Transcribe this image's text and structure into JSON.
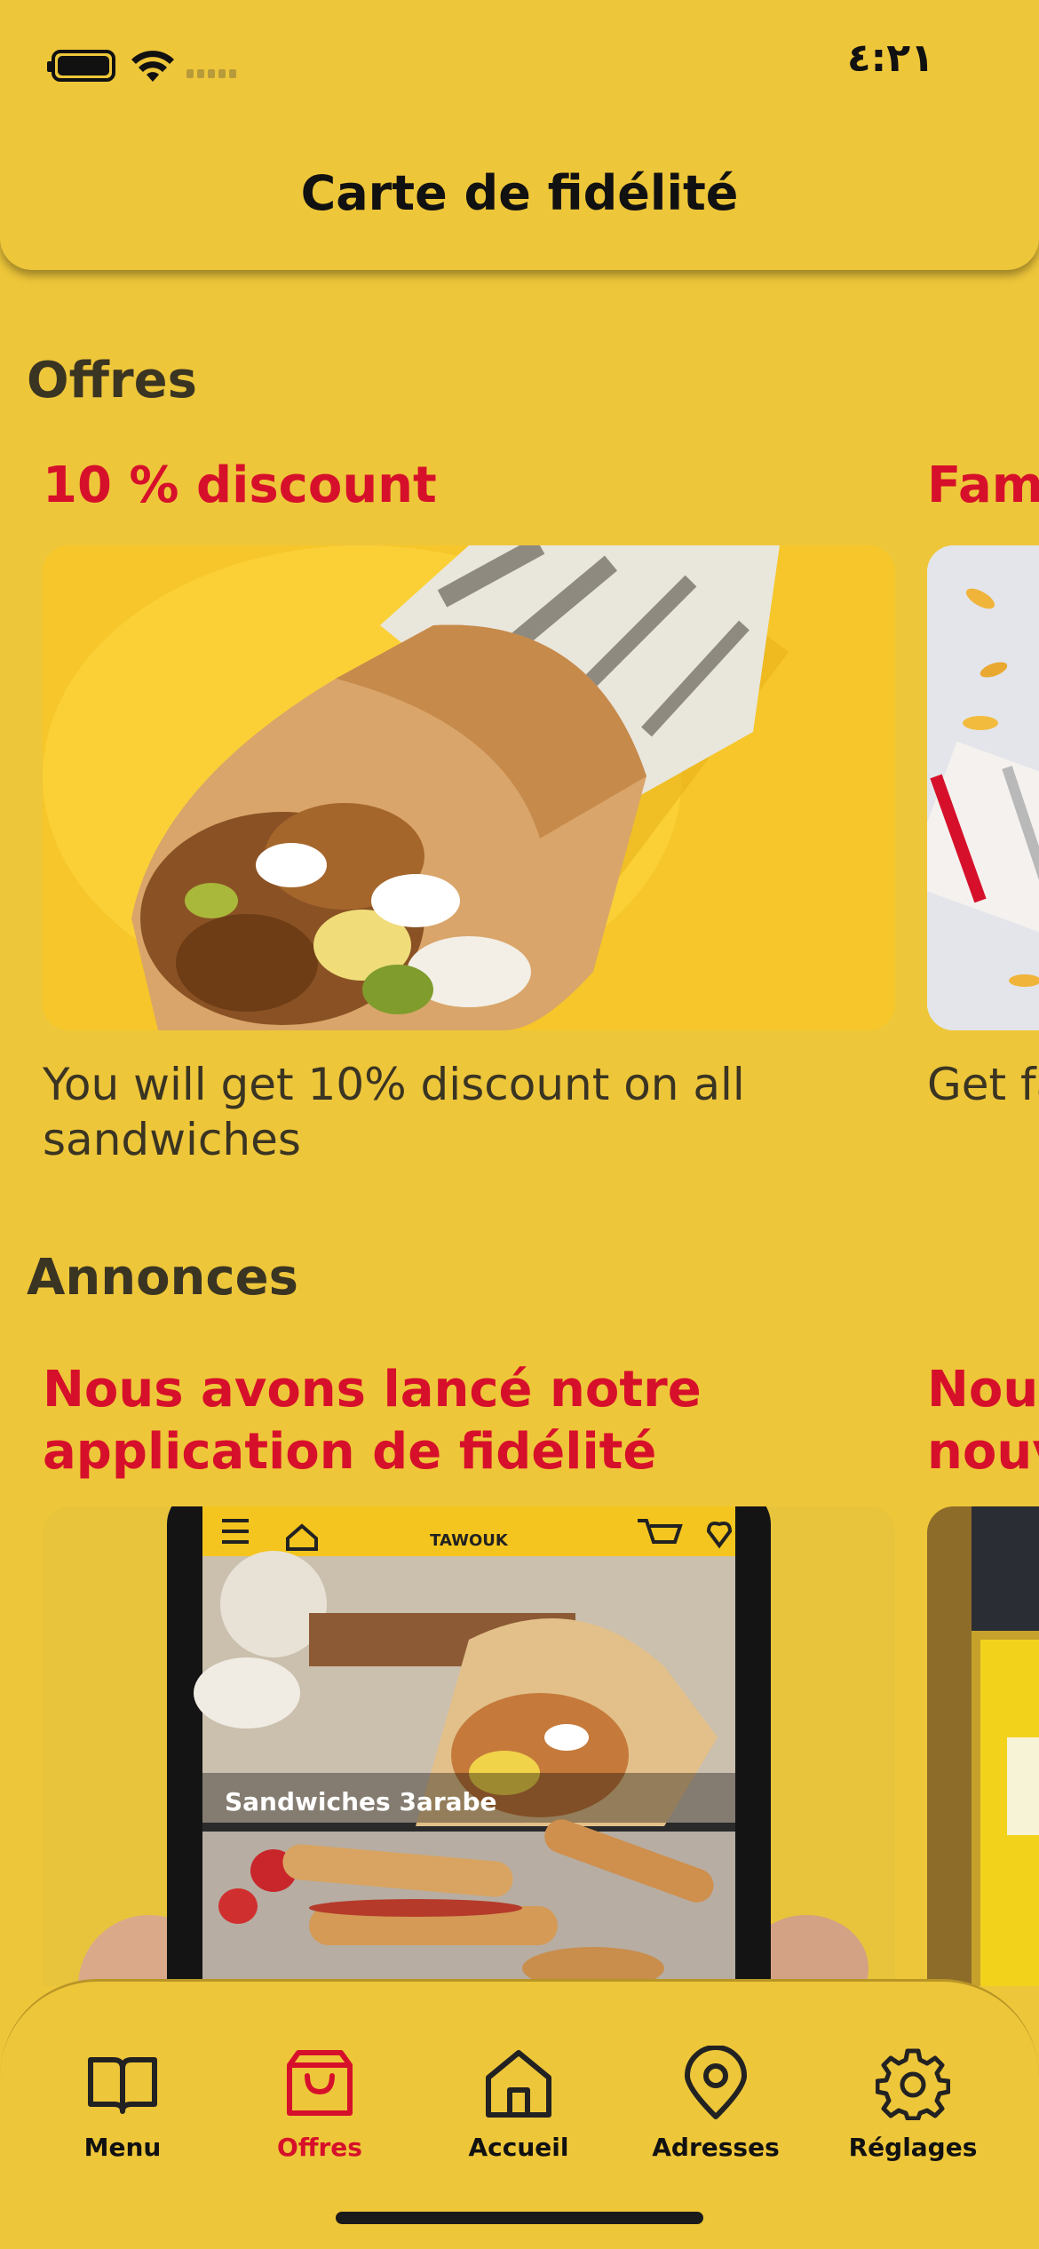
{
  "status_bar": {
    "time": "٤:٢١"
  },
  "header": {
    "title": "Carte de fidélité"
  },
  "offres": {
    "section_title": "Offres",
    "cards": [
      {
        "title": "10 % discount",
        "description": "You will get 10% discount on all sandwiches",
        "image": "tawouk-wrap-photo"
      },
      {
        "title": "Fam",
        "description": "Get fa",
        "image": "fries-wrap-photo"
      }
    ]
  },
  "annonces": {
    "section_title": "Annonces",
    "cards": [
      {
        "title_line1": "Nous avons lancé notre",
        "title_line2": "application de fidélité",
        "image": "app-phone-photo",
        "image_text": {
          "logo": "TAWOUK",
          "menu_item": "Sandwiches 3arabe"
        }
      },
      {
        "title_line1": "Nous",
        "title_line2": "nouv",
        "image": "restaurant-front-photo"
      }
    ]
  },
  "bottom_nav": {
    "active": "Offres",
    "items": [
      {
        "label": "Menu",
        "icon": "book-open-icon"
      },
      {
        "label": "Offres",
        "icon": "shopping-bag-icon"
      },
      {
        "label": "Accueil",
        "icon": "home-icon"
      },
      {
        "label": "Adresses",
        "icon": "map-pin-icon"
      },
      {
        "label": "Réglages",
        "icon": "settings-gear-icon"
      }
    ]
  },
  "colors": {
    "background": "#eec63a",
    "accent": "#d6102a",
    "text": "#3a3422"
  }
}
